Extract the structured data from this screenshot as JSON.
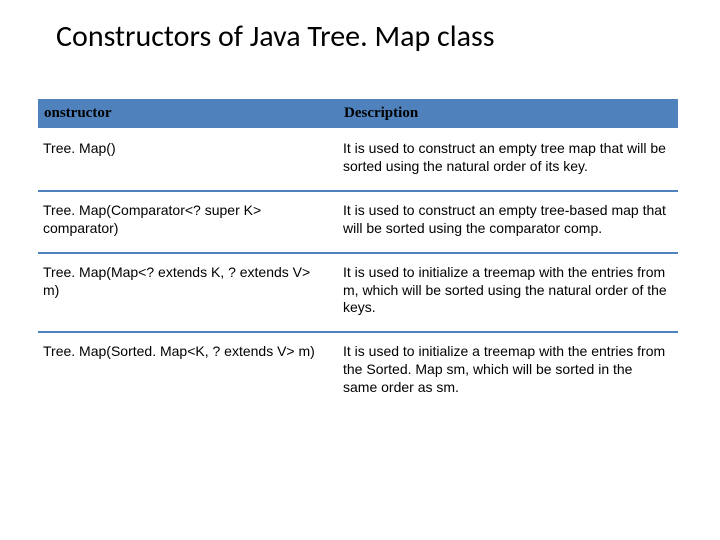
{
  "title": "Constructors of Java Tree. Map class",
  "table": {
    "headers": {
      "col1": "onstructor",
      "col2": "Description"
    },
    "rows": [
      {
        "ctor": "Tree. Map()",
        "desc": "It is used to construct an empty tree map that will be sorted using the natural order of its key."
      },
      {
        "ctor": "Tree. Map(Comparator<? super K> comparator)",
        "desc": "It is used to construct an empty tree-based map that will be sorted using the comparator comp."
      },
      {
        "ctor": "Tree. Map(Map<? extends K, ? extends V> m)",
        "desc": "It is used to initialize a treemap with the entries from m, which will be sorted using the natural order of the keys."
      },
      {
        "ctor": "Tree. Map(Sorted. Map<K, ? extends V> m)",
        "desc": "It is used to initialize a treemap with the entries from the Sorted. Map sm, which will be sorted in the same order as sm."
      }
    ]
  }
}
